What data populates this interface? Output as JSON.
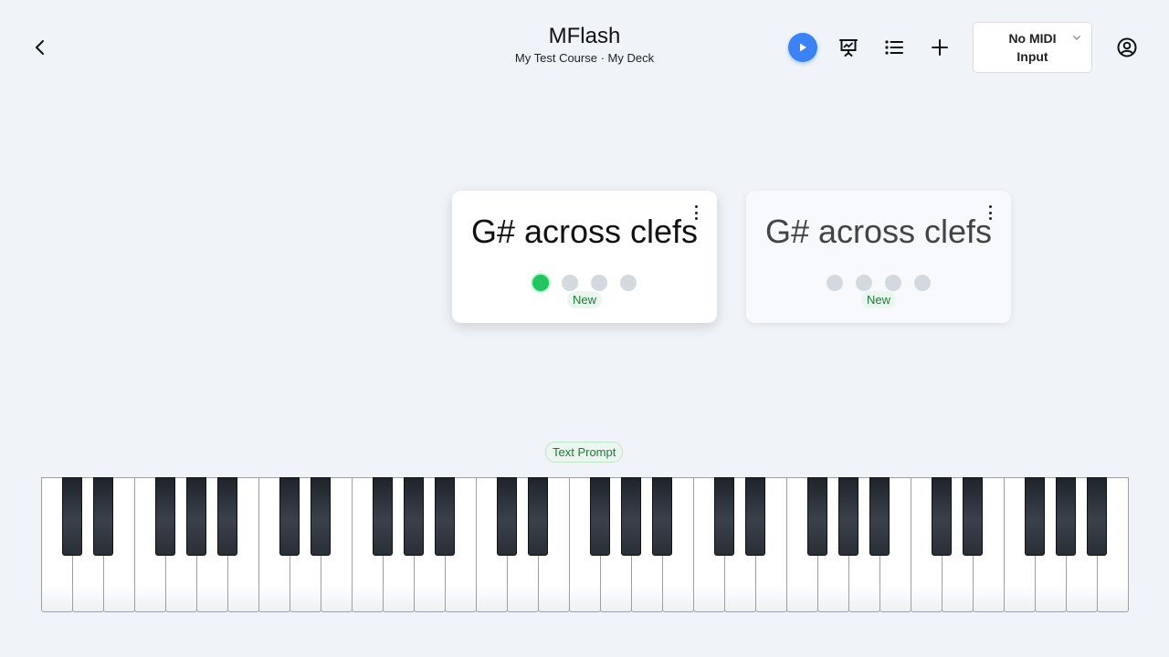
{
  "header": {
    "title": "MFlash",
    "subtitle": "My Test Course · My Deck",
    "back_icon": "chevron-left-icon"
  },
  "toolbar": {
    "play_icon": "play-icon",
    "presentation_icon": "presentation-chart-icon",
    "list_icon": "list-icon",
    "add_icon": "plus-icon",
    "midi_label": "No MIDI Input",
    "account_icon": "user-circle-icon"
  },
  "cards": [
    {
      "title": "G# across clefs",
      "badge": "New",
      "active_dot": 0,
      "dot_count": 4
    },
    {
      "title": "G# across clefs",
      "badge": "New",
      "active_dot": -1,
      "dot_count": 4
    }
  ],
  "prompt": {
    "label": "Text Prompt"
  },
  "piano": {
    "white_keys": 35,
    "octaves": 5
  },
  "colors": {
    "accent": "#3b82f6",
    "active_dot": "#22c55e",
    "badge_text": "#1f7a3a",
    "background": "#f0f3f8"
  }
}
